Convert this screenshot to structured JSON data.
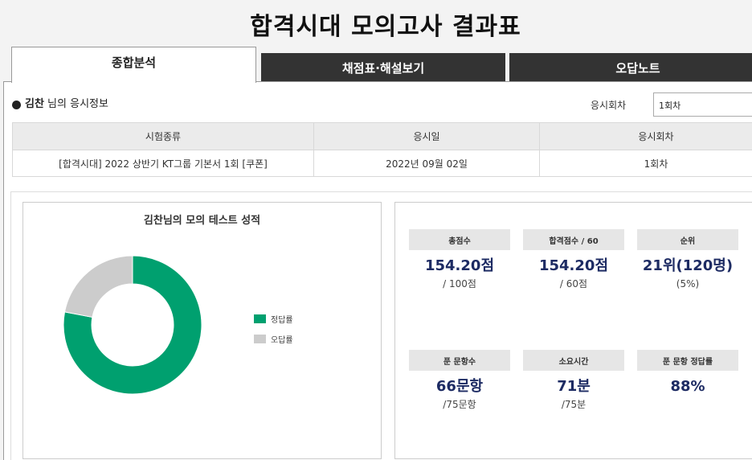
{
  "page_title": "합격시대 모의고사 결과표",
  "tabs": [
    {
      "label": "종합분석",
      "active": true
    },
    {
      "label": "채점표·해설보기",
      "active": false
    },
    {
      "label": "오답노트",
      "active": false
    }
  ],
  "info": {
    "user_name": "김찬",
    "title_suffix": " 님의 응시정보",
    "round_label": "응시회차",
    "round_selected": "1회차"
  },
  "table": {
    "headers": [
      "시험종류",
      "응시일",
      "응시회차"
    ],
    "row": [
      "[합격시대] 2022 상반기 KT그룹 기본서 1회 [쿠폰]",
      "2022년 09월 02일",
      "1회차"
    ]
  },
  "chart": {
    "title": "김찬님의 모의 테스트 성적",
    "colors": {
      "correct": "#00a06f",
      "wrong": "#cccccc"
    }
  },
  "chart_data": {
    "type": "pie",
    "donut": true,
    "categories": [
      "정답률",
      "오답률"
    ],
    "values": [
      78,
      22
    ],
    "legend": "right"
  },
  "stats": [
    {
      "label": "총점수",
      "value": "154.20점",
      "sub": "/ 100점"
    },
    {
      "label": "합격점수 / 60",
      "value": "154.20점",
      "sub": "/ 60점"
    },
    {
      "label": "순위",
      "value": "21위(120명)",
      "sub": "(5%)"
    },
    {
      "label": "푼 문항수",
      "value": "66문항",
      "sub": "/75문항"
    },
    {
      "label": "소요시간",
      "value": "71분",
      "sub": "/75분"
    },
    {
      "label": "푼 문항 정답률",
      "value": "88%",
      "sub": ""
    }
  ]
}
